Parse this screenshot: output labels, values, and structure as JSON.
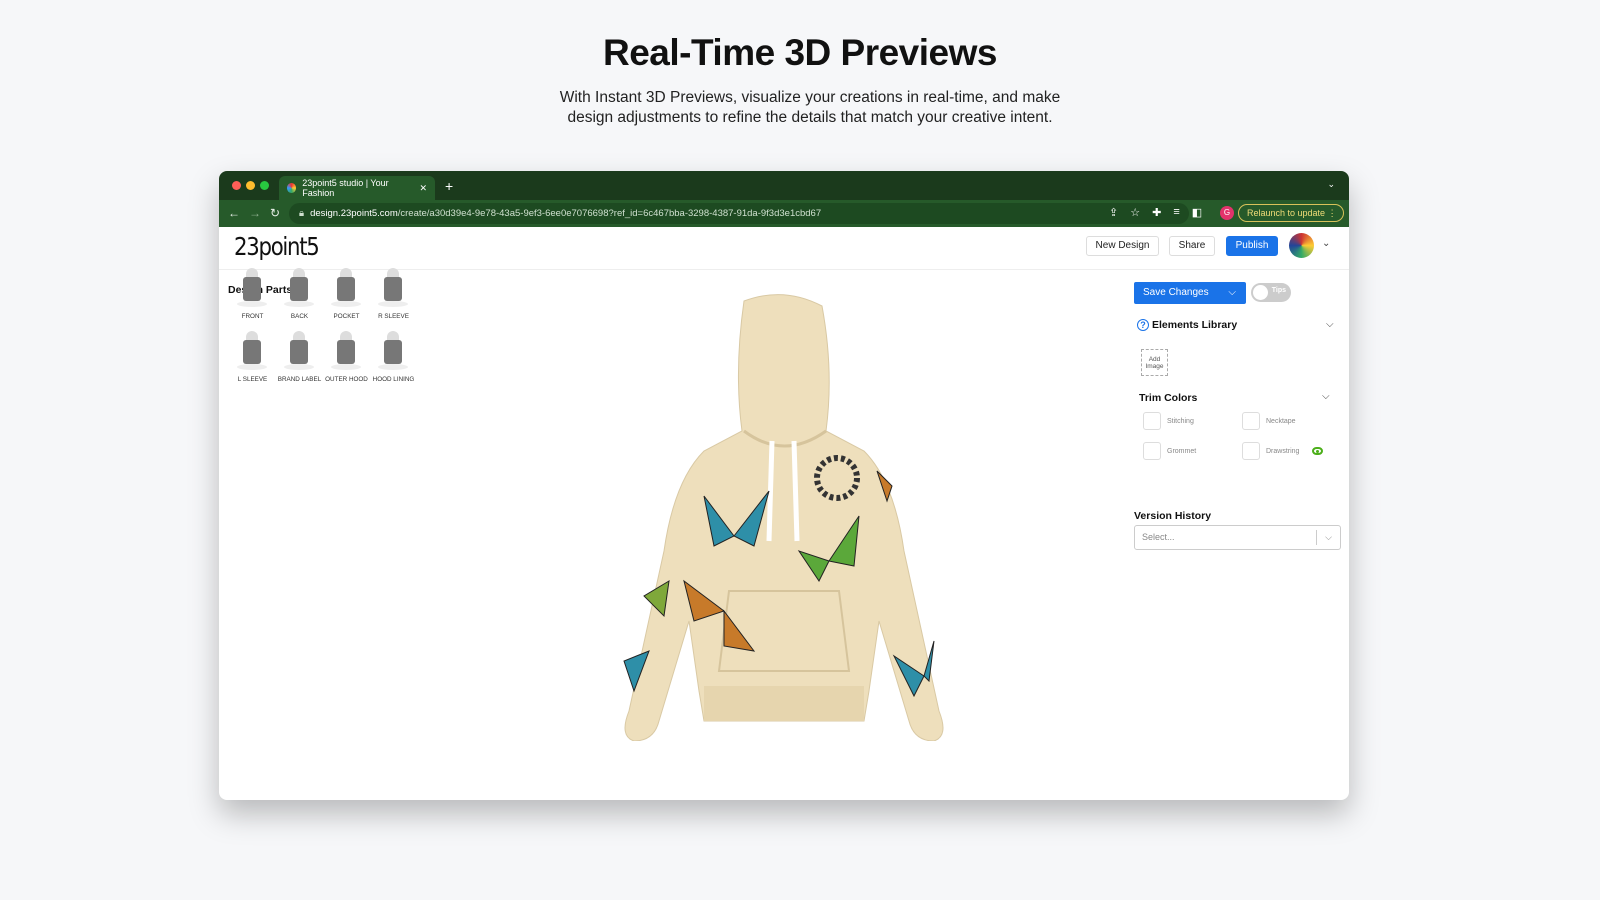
{
  "hero": {
    "title": "Real-Time 3D Previews",
    "subtitle": "With Instant 3D Previews, visualize your creations in real-time, and make design adjustments to refine the details that match your creative intent."
  },
  "browser": {
    "tab_title": "23point5 studio | Your Fashion",
    "url_domain": "design.23point5.com",
    "url_path": "/create/a30d39e4-9e78-43a5-9ef3-6ee0e7076698?ref_id=6c467bba-3298-4387-91da-9f3d3e1cbd67",
    "profile_initial": "G",
    "relaunch_label": "Relaunch to update"
  },
  "app": {
    "logo": "23point5",
    "new_design": "New Design",
    "share": "Share",
    "publish": "Publish"
  },
  "design_parts": {
    "title": "Design Parts",
    "items": [
      "FRONT",
      "BACK",
      "POCKET",
      "R SLEEVE",
      "L SLEEVE",
      "BRAND LABEL",
      "OUTER HOOD",
      "HOOD LINING"
    ]
  },
  "right": {
    "save_changes": "Save Changes",
    "tips": "Tips",
    "elements_library": "Elements Library",
    "add_image": "Add Image",
    "trim_colors": "Trim Colors",
    "trims": [
      "Stitching",
      "Necktape",
      "Grommet",
      "Drawstring"
    ],
    "version_history": "Version History",
    "version_placeholder": "Select..."
  },
  "colors": {
    "accent": "#1a73e8",
    "browser_bar": "#1b3a1c",
    "garment": "#eedfbc"
  }
}
